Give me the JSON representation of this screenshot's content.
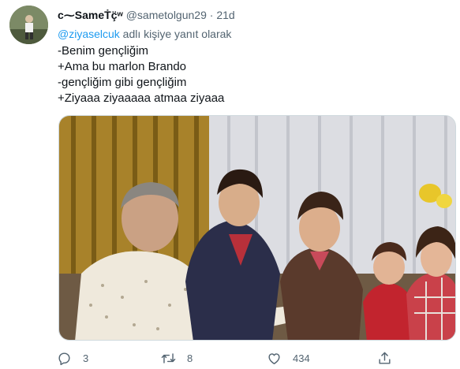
{
  "tweet": {
    "display_name": "ᴄ⁓SameṪç̈ʷ",
    "handle": "@sametolgun29",
    "separator": "·",
    "time": "21d",
    "reply_mention": "@ziyaselcuk",
    "reply_suffix": " adlı kişiye yanıt olarak",
    "lines": [
      "-Benim gençliğim",
      "+Ama bu marlon Brando",
      "-gençliğim gibi gençliğim",
      "+Ziyaaa ziyaaaaa atmaa ziyaaa"
    ]
  },
  "actions": {
    "reply_count": "3",
    "retweet_count": "8",
    "like_count": "434"
  },
  "icons": {
    "reply": "reply-icon",
    "retweet": "retweet-icon",
    "like": "heart-icon",
    "share": "share-icon"
  },
  "colors": {
    "accent": "#1d9bf0",
    "secondary_text": "#536471"
  }
}
